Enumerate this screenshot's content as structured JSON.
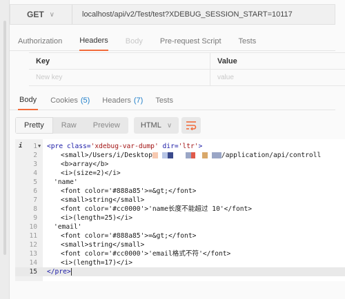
{
  "request": {
    "method": "GET",
    "url": "localhost/api/v2/Test/test?XDEBUG_SESSION_START=10117"
  },
  "request_tabs": [
    "Authorization",
    "Headers",
    "Body",
    "Pre-request Script",
    "Tests"
  ],
  "headers_table": {
    "key_header": "Key",
    "value_header": "Value",
    "key_placeholder": "New key",
    "value_placeholder": "value"
  },
  "response_tabs": {
    "body": "Body",
    "cookies": "Cookies",
    "cookies_count": "(5)",
    "headers": "Headers",
    "headers_count": "(7)",
    "tests": "Tests"
  },
  "view_modes": [
    "Pretty",
    "Raw",
    "Preview"
  ],
  "format": "HTML",
  "code": {
    "line_numbers": [
      "1",
      "2",
      "3",
      "4",
      "5",
      "6",
      "7",
      "8",
      "9",
      "10",
      "11",
      "12",
      "13",
      "14",
      "15"
    ],
    "info_marker": "i",
    "l1a": "<pre ",
    "l1b": "class=",
    "l1c": "'xdebug-var-dump'",
    "l1d": " dir=",
    "l1e": "'ltr'",
    "l1f": ">",
    "l2a": "<small>/Users/i/Desktop",
    "l2b": "/application/api/controll",
    "l3": "<b>array</b>",
    "l4": "<i>(size=2)</i>",
    "l5": "'name'",
    "l6": "<font color='#888a85'>=&gt;</font>",
    "l7": "<small>string</small>",
    "l8": "<font color='#cc0000'>'name长度不能超过 10'</font>",
    "l9": "<i>(length=25)</i>",
    "l10": "'email'",
    "l11": "<font color='#888a85'>=&gt;</font>",
    "l12": "<small>string</small>",
    "l13": "<font color='#cc0000'>'email格式不符'</font>",
    "l14": "<i>(length=17)</i>",
    "l15": "</pre>"
  },
  "colors": {
    "accent": "#f26b3a",
    "count_blue": "#1f7ec9",
    "tag_blue": "#1a1aa6",
    "string_red": "#a31515"
  },
  "icons": {
    "method_dropdown": "chevron-down-icon",
    "format_dropdown": "chevron-down-icon",
    "wrap": "wrap-lines-icon"
  }
}
